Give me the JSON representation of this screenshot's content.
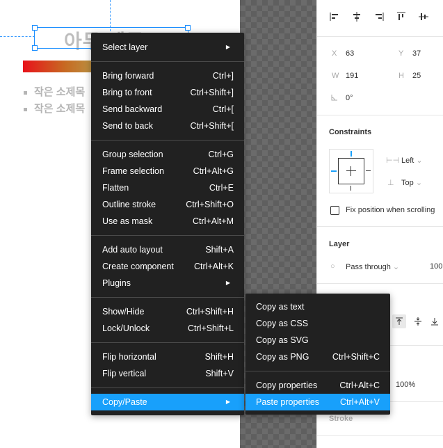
{
  "canvas": {
    "title_text": "아두 제목",
    "bullets": [
      "작은 소제목",
      "작은 소제목"
    ]
  },
  "panel": {
    "align_icons": [
      "align-left-icon",
      "align-horizontal-center-icon",
      "align-right-icon",
      "align-top-icon",
      "align-vertical-center-icon"
    ],
    "x_label": "X",
    "x_value": "63",
    "y_label": "Y",
    "y_value": "37",
    "w_label": "W",
    "w_value": "191",
    "h_label": "H",
    "h_value": "25",
    "rotation_value": "0°",
    "constraints_title": "Constraints",
    "constraint_h": "Left",
    "constraint_v": "Top",
    "fix_position_label": "Fix position when scrolling",
    "layer_title": "Layer",
    "blend_mode": "Pass through",
    "layer_opacity": "100",
    "text_opacity": "100%",
    "stroke_title": "Stroke"
  },
  "main_menu": {
    "groups": [
      [
        {
          "label": "Select layer",
          "shortcut": "",
          "submenu": true
        }
      ],
      [
        {
          "label": "Bring forward",
          "shortcut": "Ctrl+]"
        },
        {
          "label": "Bring to front",
          "shortcut": "Ctrl+Shift+]"
        },
        {
          "label": "Send backward",
          "shortcut": "Ctrl+["
        },
        {
          "label": "Send to back",
          "shortcut": "Ctrl+Shift+["
        }
      ],
      [
        {
          "label": "Group selection",
          "shortcut": "Ctrl+G"
        },
        {
          "label": "Frame selection",
          "shortcut": "Ctrl+Alt+G"
        },
        {
          "label": "Flatten",
          "shortcut": "Ctrl+E"
        },
        {
          "label": "Outline stroke",
          "shortcut": "Ctrl+Shift+O"
        },
        {
          "label": "Use as mask",
          "shortcut": "Ctrl+Alt+M"
        }
      ],
      [
        {
          "label": "Add auto layout",
          "shortcut": "Shift+A"
        },
        {
          "label": "Create component",
          "shortcut": "Ctrl+Alt+K"
        },
        {
          "label": "Plugins",
          "shortcut": "",
          "submenu": true
        }
      ],
      [
        {
          "label": "Show/Hide",
          "shortcut": "Ctrl+Shift+H"
        },
        {
          "label": "Lock/Unlock",
          "shortcut": "Ctrl+Shift+L"
        }
      ],
      [
        {
          "label": "Flip horizontal",
          "shortcut": "Shift+H"
        },
        {
          "label": "Flip vertical",
          "shortcut": "Shift+V"
        }
      ],
      [
        {
          "label": "Copy/Paste",
          "shortcut": "",
          "submenu": true,
          "active": true
        }
      ]
    ]
  },
  "sub_menu": {
    "groups": [
      [
        {
          "label": "Copy as text",
          "shortcut": ""
        },
        {
          "label": "Copy as CSS",
          "shortcut": ""
        },
        {
          "label": "Copy as SVG",
          "shortcut": ""
        },
        {
          "label": "Copy as PNG",
          "shortcut": "Ctrl+Shift+C"
        }
      ],
      [
        {
          "label": "Copy properties",
          "shortcut": "Ctrl+Alt+C"
        },
        {
          "label": "Paste properties",
          "shortcut": "Ctrl+Alt+V",
          "active": true
        }
      ]
    ]
  },
  "colors": {
    "accent": "#18a0fb",
    "menu_bg": "#212121",
    "selection": "#1e90ff"
  }
}
